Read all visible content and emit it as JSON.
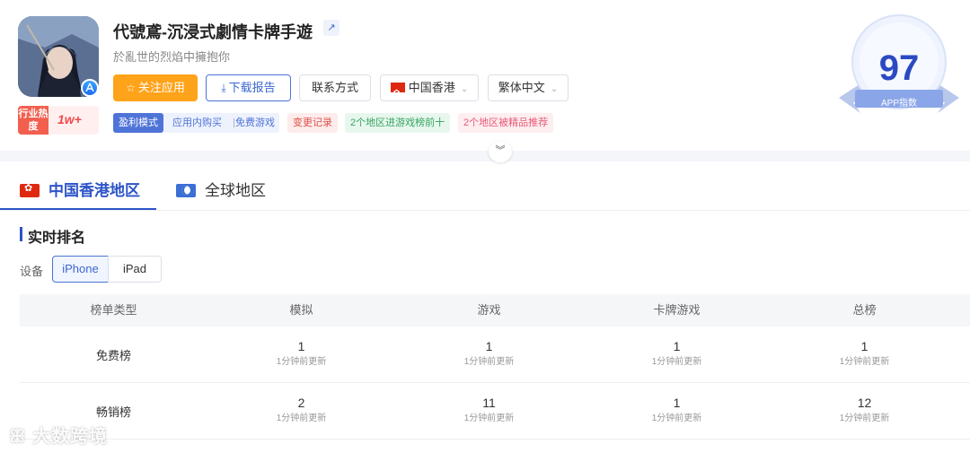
{
  "app": {
    "title": "代號鳶-沉浸式劇情卡牌手遊",
    "subtitle": "於亂世的烈焰中擁抱你",
    "heat_label": "行业热度",
    "heat_value": "1w+"
  },
  "actions": {
    "follow": "关注应用",
    "download": "下载报告",
    "contact": "联系方式",
    "region": "中国香港",
    "language": "繁体中文"
  },
  "tags": {
    "model": "盈利模式",
    "iap": "应用内购买",
    "separator": "|",
    "free": "免费游戏",
    "change_log": "变更记录",
    "top10": "2个地区进游戏榜前十",
    "featured": "2个地区被精品推荐"
  },
  "score": {
    "value": "97",
    "label": "APP指数"
  },
  "tabs": [
    {
      "label": "中国香港地区",
      "active": true
    },
    {
      "label": "全球地区",
      "active": false
    }
  ],
  "ranking": {
    "title": "实时排名",
    "device_label": "设备",
    "devices": [
      "iPhone",
      "iPad"
    ],
    "selected_device": "iPhone",
    "columns": [
      "榜单类型",
      "模拟",
      "游戏",
      "卡牌游戏",
      "总榜"
    ],
    "rows": [
      {
        "name": "免费榜",
        "cells": [
          {
            "rank": "1",
            "updated": "1分钟前更新"
          },
          {
            "rank": "1",
            "updated": "1分钟前更新"
          },
          {
            "rank": "1",
            "updated": "1分钟前更新"
          },
          {
            "rank": "1",
            "updated": "1分钟前更新"
          }
        ]
      },
      {
        "name": "畅销榜",
        "cells": [
          {
            "rank": "2",
            "updated": "1分钟前更新"
          },
          {
            "rank": "11",
            "updated": "1分钟前更新"
          },
          {
            "rank": "1",
            "updated": "1分钟前更新"
          },
          {
            "rank": "12",
            "updated": "1分钟前更新"
          }
        ]
      }
    ]
  },
  "watermark": "大数跨境",
  "colors": {
    "accent": "#2d54c8",
    "follow": "#ffa31a",
    "score": "#2b4ac2"
  }
}
